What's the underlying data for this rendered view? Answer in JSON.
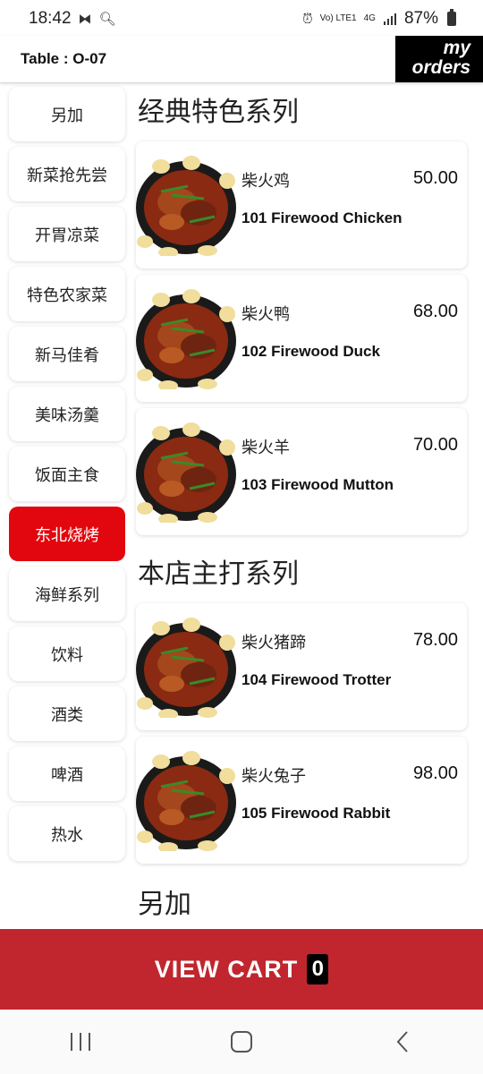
{
  "status_bar": {
    "time": "18:42",
    "battery_percent": "87%",
    "network": "4G",
    "volte": "Vo) LTE1"
  },
  "header": {
    "table_label": "Table : O-07",
    "my_orders_line1": "my",
    "my_orders_line2": "orders"
  },
  "categories": [
    {
      "label": "另加",
      "active": false
    },
    {
      "label": "新菜抢先尝",
      "active": false
    },
    {
      "label": "开胃凉菜",
      "active": false
    },
    {
      "label": "特色农家菜",
      "active": false
    },
    {
      "label": "新马佳肴",
      "active": false
    },
    {
      "label": "美味汤羹",
      "active": false
    },
    {
      "label": "饭面主食",
      "active": false
    },
    {
      "label": "东北烧烤",
      "active": true
    },
    {
      "label": "海鲜系列",
      "active": false
    },
    {
      "label": "饮料",
      "active": false
    },
    {
      "label": "酒类",
      "active": false
    },
    {
      "label": "啤酒",
      "active": false
    },
    {
      "label": "热水",
      "active": false
    }
  ],
  "sections": [
    {
      "title": "经典特色系列",
      "items": [
        {
          "name_cn": "柴火鸡",
          "name_en": "101 Firewood Chicken",
          "price": "50.00"
        },
        {
          "name_cn": "柴火鸭",
          "name_en": "102 Firewood Duck",
          "price": "68.00"
        },
        {
          "name_cn": "柴火羊",
          "name_en": "103 Firewood Mutton",
          "price": "70.00"
        }
      ]
    },
    {
      "title": "本店主打系列",
      "items": [
        {
          "name_cn": "柴火猪蹄",
          "name_en": "104 Firewood Trotter",
          "price": "78.00"
        },
        {
          "name_cn": "柴火兔子",
          "name_en": "105 Firewood Rabbit",
          "price": "98.00"
        }
      ]
    },
    {
      "title": "另加",
      "items": []
    }
  ],
  "cart": {
    "label": "VIEW CART",
    "count": "0"
  },
  "colors": {
    "accent_red": "#e2070e",
    "cart_red": "#c1262e",
    "black": "#000000"
  },
  "nav_icons": [
    "recent-apps-icon",
    "home-icon",
    "back-icon"
  ]
}
